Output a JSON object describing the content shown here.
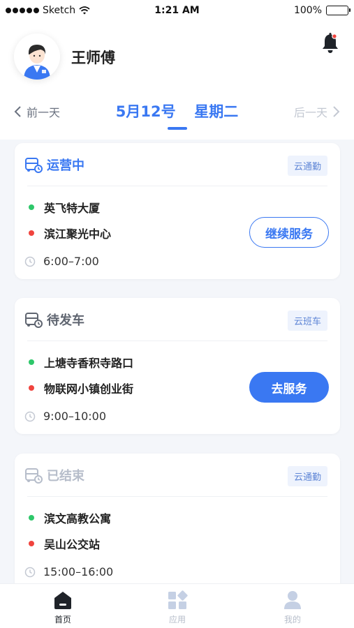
{
  "status_bar": {
    "carrier": "Sketch",
    "time": "1:21 AM",
    "battery": "100%",
    "battery_level": 1.0
  },
  "header": {
    "user_name": "王师傅",
    "notification_icon": "bell-icon",
    "has_unread": true
  },
  "date_nav": {
    "prev_label": "前一天",
    "next_label": "后一天",
    "date": "5月12号",
    "weekday": "星期二"
  },
  "colors": {
    "accent": "#3a78f2",
    "active_status": "#3a78f2",
    "pending_status": "#5f6570",
    "finished_status": "#b6bdca",
    "start_dot": "#2ec76a",
    "end_dot": "#f0443e"
  },
  "trips": [
    {
      "status": "运营中",
      "tag": "云通勤",
      "from": "英飞特大厦",
      "to": "滨江聚光中心",
      "time": "6:00–7:00",
      "action": "继续服务"
    },
    {
      "status": "待发车",
      "tag": "云班车",
      "from": "上塘寺香积寺路口",
      "to": "物联网小镇创业街",
      "time": "9:00–10:00",
      "action": "去服务"
    },
    {
      "status": "已结束",
      "tag": "云通勤",
      "from": "滨文高教公寓",
      "to": "吴山公交站",
      "time": "15:00–16:00"
    }
  ],
  "tab_bar": {
    "tabs": [
      {
        "label": "首页",
        "icon": "home-icon",
        "active": true
      },
      {
        "label": "应用",
        "icon": "apps-icon",
        "active": false
      },
      {
        "label": "我的",
        "icon": "profile-icon",
        "active": false
      }
    ]
  }
}
